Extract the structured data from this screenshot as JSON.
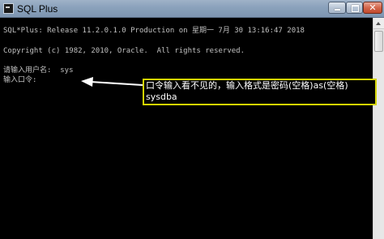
{
  "window": {
    "title": "SQL Plus"
  },
  "console": {
    "lines": [
      "SQL*Plus: Release 11.2.0.1.0 Production on 星期一 7月 30 13:16:47 2018",
      "Copyright (c) 1982, 2010, Oracle.  All rights reserved.",
      "请输入用户名:  sys",
      "输入口令:"
    ]
  },
  "annotation": {
    "line1": "口令输入看不见的，输入格式是密码(空格)as(空格)",
    "line2": "sysdba",
    "border_color": "#d4d400",
    "text_color": "#ffffff"
  },
  "icons": {
    "app": "sqlplus-console-icon",
    "minimize": "minimize-icon",
    "maximize": "maximize-icon",
    "close": "close-icon"
  }
}
